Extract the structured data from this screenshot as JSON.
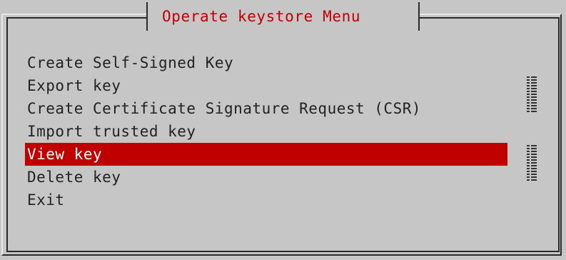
{
  "dialog": {
    "title": "Operate keystore Menu",
    "selected_index": 4,
    "items": [
      {
        "label": "Create Self-Signed Key"
      },
      {
        "label": "Export key"
      },
      {
        "label": "Create Certificate Signature Request (CSR)"
      },
      {
        "label": "Import trusted key"
      },
      {
        "label": "View key"
      },
      {
        "label": "Delete key"
      },
      {
        "label": "Exit"
      }
    ]
  },
  "colors": {
    "background": "#c6c6c6",
    "title_text": "#c00000",
    "selection_bg": "#c00000",
    "selection_text": "#ffffff",
    "item_text": "#222222"
  }
}
